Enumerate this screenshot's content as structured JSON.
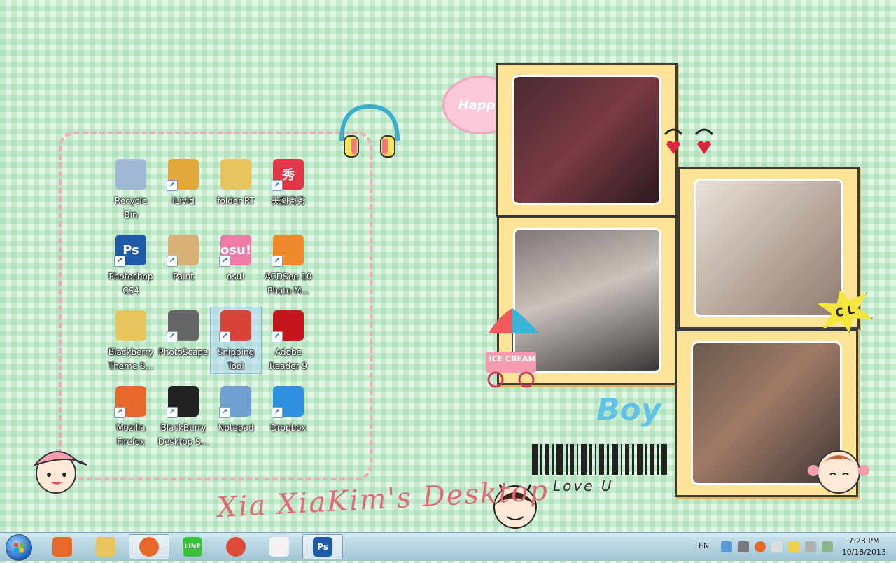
{
  "desktop": {
    "title": "Xia XiaKim's Desktop",
    "stickers": {
      "happy": "Happy",
      "boy": "Boy",
      "love": "Love U",
      "ice_cream": "ICE CREAM",
      "cl": "C L"
    },
    "icons": [
      {
        "label": "Recycle\nBin",
        "icon": "recycle-bin-icon",
        "color": "#9fb8d8"
      },
      {
        "label": "iLivid",
        "icon": "ilivid-icon",
        "color": "#e3a83a"
      },
      {
        "label": "folder RT",
        "icon": "folder-icon",
        "color": "#e7c55c"
      },
      {
        "label": "美图秀秀",
        "icon": "meitu-xiuxiu-icon",
        "color": "#e0364a",
        "glyph": "秀"
      },
      {
        "label": "Photoshop\nCS4",
        "icon": "photoshop-icon",
        "color": "#1e5aa8",
        "glyph": "Ps"
      },
      {
        "label": "Paint",
        "icon": "paint-palette-icon",
        "color": "#d9b27a"
      },
      {
        "label": "osu!",
        "icon": "osu-icon",
        "color": "#f07aa8",
        "glyph": "osu!"
      },
      {
        "label": "ACDSee 10\nPhoto M...",
        "icon": "acdsee-icon",
        "color": "#f08a2a"
      },
      {
        "label": "Blackberry\nTheme S...",
        "icon": "folder-icon",
        "color": "#e7c55c"
      },
      {
        "label": "PhotoScape",
        "icon": "photoscape-icon",
        "color": "#666666"
      },
      {
        "label": "Snipping\nTool",
        "icon": "snipping-tool-icon",
        "color": "#d8443a"
      },
      {
        "label": "Adobe\nReader 9",
        "icon": "adobe-reader-icon",
        "color": "#c4161c"
      },
      {
        "label": "Mozilla\nFirefox",
        "icon": "firefox-icon",
        "color": "#e8682a"
      },
      {
        "label": "BlackBerry\nDesktop S...",
        "icon": "blackberry-icon",
        "color": "#222222"
      },
      {
        "label": "Notepad",
        "icon": "notepad-icon",
        "color": "#6fa0d0"
      },
      {
        "label": "Dropbox",
        "icon": "dropbox-icon",
        "color": "#2e8fe0"
      }
    ]
  },
  "taskbar": {
    "buttons": [
      {
        "icon": "media-player-icon",
        "color": "#e86a2a"
      },
      {
        "icon": "file-explorer-icon",
        "color": "#e7c55c"
      },
      {
        "icon": "firefox-icon",
        "color": "#e8682a"
      },
      {
        "icon": "line-icon",
        "color": "#3cc13c",
        "glyph": "LINE"
      },
      {
        "icon": "chrome-icon",
        "color": "#dd4b39"
      },
      {
        "icon": "apps-grid-icon",
        "color": "#f2f2f2"
      },
      {
        "icon": "photoshop-icon",
        "color": "#1e5aa8",
        "glyph": "Ps"
      }
    ],
    "language": "EN",
    "time": "7:23 PM",
    "date": "10/18/2013"
  }
}
